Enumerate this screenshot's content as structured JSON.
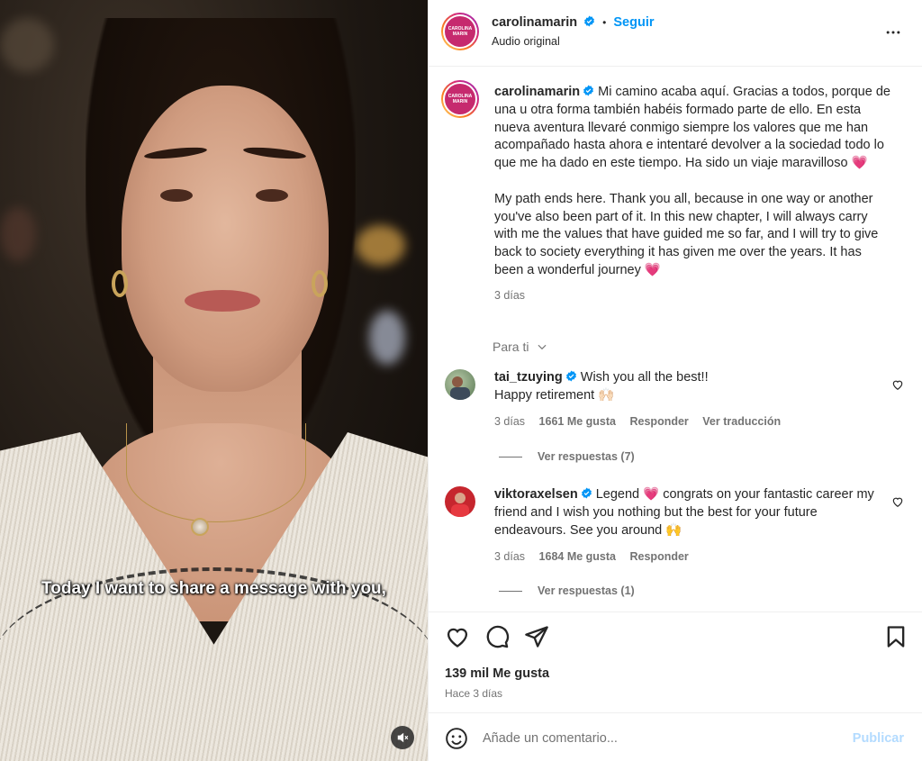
{
  "video": {
    "caption": "Today I want to share a message with you,",
    "mute_icon": "speaker-muted-icon"
  },
  "header": {
    "username": "carolinamarin",
    "separator": "•",
    "follow_label": "Seguir",
    "audio_label": "Audio original",
    "more_icon": "more-horizontal-icon"
  },
  "post": {
    "username": "carolinamarin",
    "caption_es": "Mi camino acaba aquí. Gracias a todos, porque de una u otra forma también habéis formado parte de ello. En esta nueva aventura llevaré conmigo siempre los valores que me han acompañado hasta ahora e intentaré devolver a la sociedad todo lo que me ha dado en este tiempo. Ha sido un viaje maravilloso",
    "caption_en": "My path ends here. Thank you all, because in one way or another you've also been part of it. In this new chapter, I will always carry with me the values that have guided me so far, and I will try to give back to society everything it has given me over the years. It has been a wonderful journey",
    "heart_emoji": "💗",
    "time": "3 días"
  },
  "filter": {
    "label": "Para ti"
  },
  "comments": [
    {
      "username": "tai_tzuying",
      "text": "Wish you all the best!! ",
      "text2": "Happy retirement 🙌🏻",
      "time": "3 días",
      "likes": "1661 Me gusta",
      "reply": "Responder",
      "translate": "Ver traducción",
      "view_replies": "Ver respuestas (7)"
    },
    {
      "username": "viktoraxelsen",
      "text_a": "Legend ",
      "heart": "💗",
      "text_b": " congrats on your fantastic career my friend and I wish you nothing but the best for your future endeavours. See you around 🙌",
      "time": "3 días",
      "likes": "1684 Me gusta",
      "reply": "Responder",
      "view_replies": "Ver respuestas (1)"
    }
  ],
  "actions": {
    "likes": "139 mil Me gusta",
    "ago": "Hace 3 días"
  },
  "composer": {
    "placeholder": "Añade un comentario...",
    "publish_label": "Publicar"
  },
  "colors": {
    "accent": "#0095f6",
    "secondary_text": "#737373",
    "border": "#efefef",
    "publish_disabled": "#b3dbff"
  }
}
